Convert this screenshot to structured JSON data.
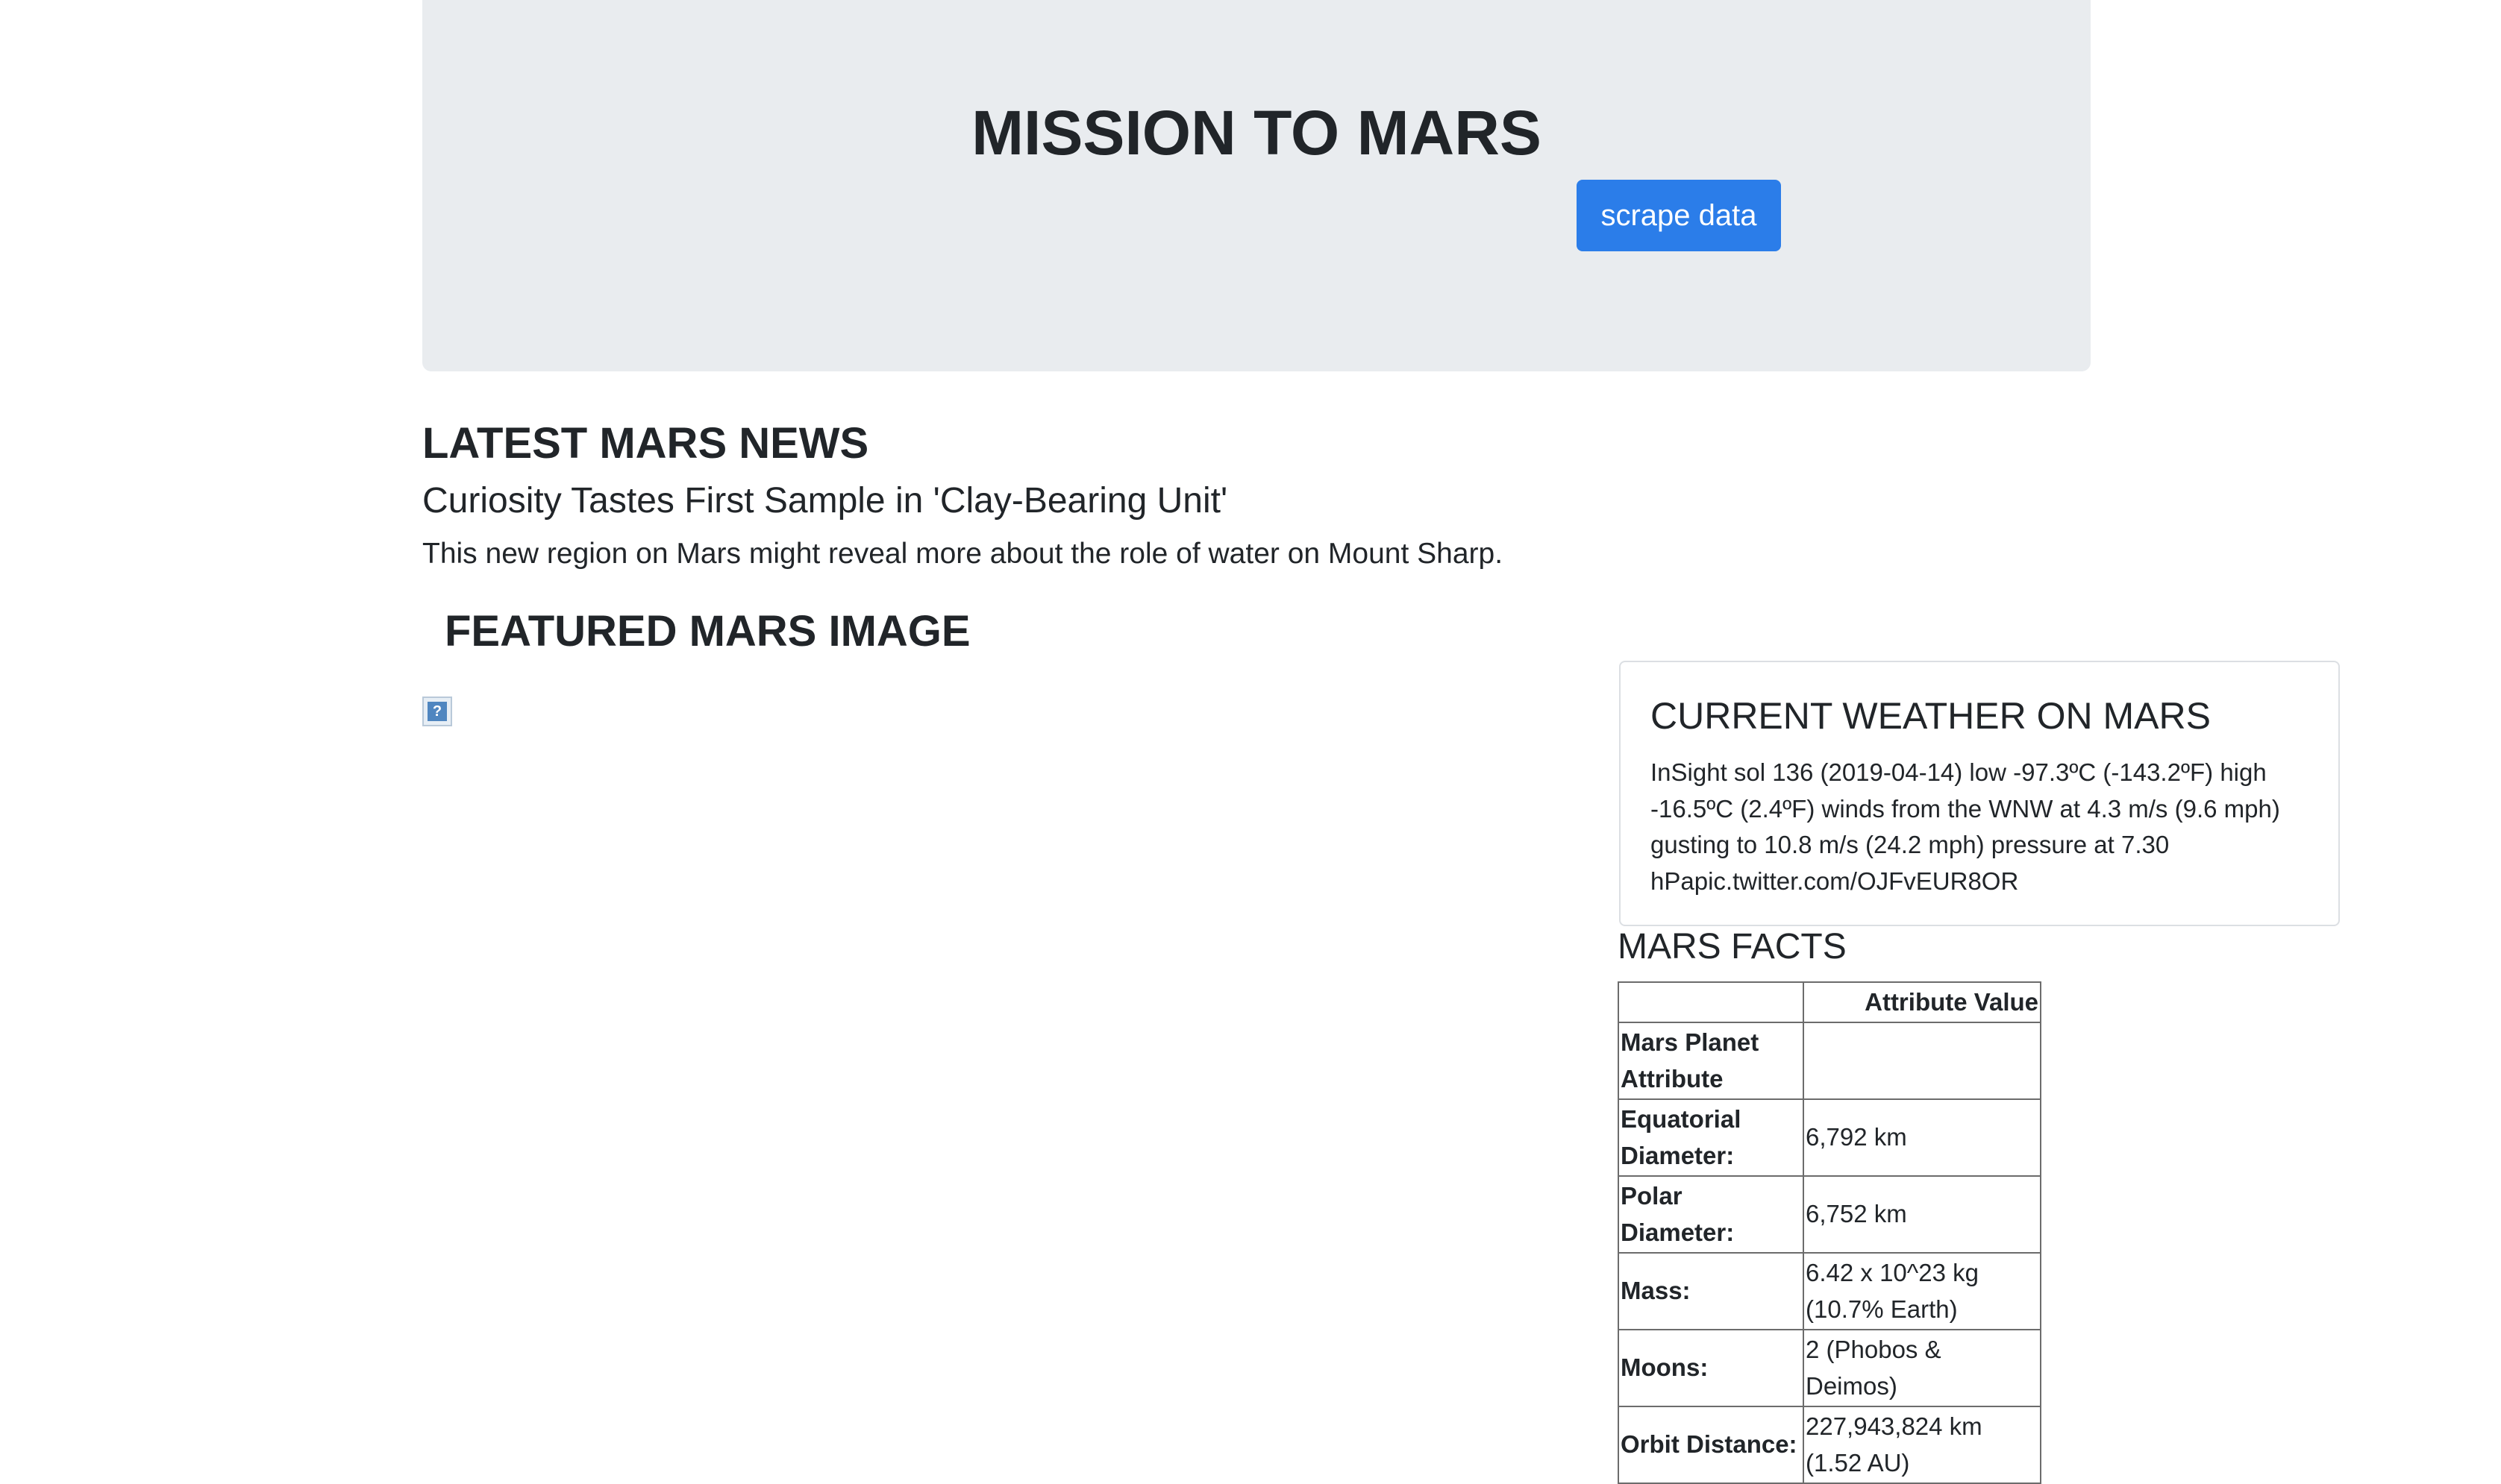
{
  "header": {
    "title": "MISSION TO MARS",
    "scrape_label": "scrape data"
  },
  "news": {
    "heading": "LATEST MARS NEWS",
    "title": "Curiosity Tastes First Sample in 'Clay-Bearing Unit'",
    "teaser": "This new region on Mars might reveal more about the role of water on Mount Sharp."
  },
  "featured": {
    "heading": "FEATURED MARS IMAGE",
    "broken_glyph": "?",
    "image_icon": "broken-image-icon"
  },
  "weather": {
    "heading": "CURRENT WEATHER ON MARS",
    "text": "InSight sol 136 (2019-04-14) low -97.3ºC (-143.2ºF) high -16.5ºC (2.4ºF) winds from the WNW at 4.3 m/s (9.6 mph) gusting to 10.8 m/s (24.2 mph) pressure at 7.30 hPapic.twitter.com/OJFvEUR8OR"
  },
  "facts": {
    "heading": "MARS FACTS",
    "columns": [
      "",
      "Attribute Value"
    ],
    "rows": [
      {
        "attr": "Mars Planet Attribute",
        "value": ""
      },
      {
        "attr": "Equatorial Diameter:",
        "value": "6,792 km"
      },
      {
        "attr": "Polar Diameter:",
        "value": "6,752 km"
      },
      {
        "attr": "Mass:",
        "value": "6.42 x 10^23 kg (10.7% Earth)"
      },
      {
        "attr": "Moons:",
        "value": "2 (Phobos & Deimos)"
      },
      {
        "attr": "Orbit Distance:",
        "value": "227,943,824 km (1.52 AU)"
      }
    ]
  },
  "colors": {
    "jumbotron_bg": "#e9ecef",
    "button_bg": "#2b7de9",
    "text": "#212529"
  }
}
